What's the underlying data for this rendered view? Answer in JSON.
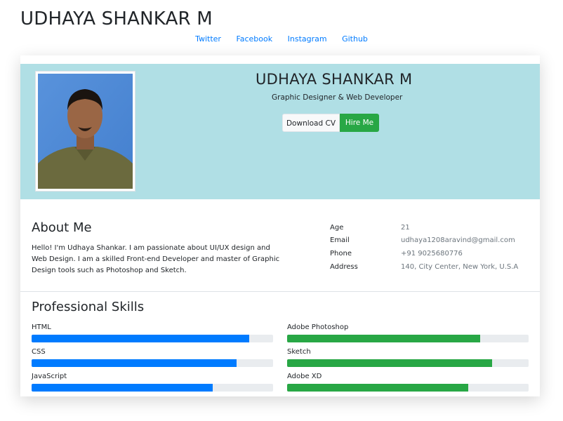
{
  "site": {
    "title": "UDHAYA SHANKAR M",
    "social": [
      "Twitter",
      "Facebook",
      "Instagram",
      "Github"
    ]
  },
  "hero": {
    "name": "UDHAYA SHANKAR M",
    "role": "Graphic Designer & Web Developer",
    "download_label": "Download CV",
    "hire_label": "Hire Me",
    "background_color": "#b0dfe5"
  },
  "about": {
    "title": "About Me",
    "text": "Hello! I'm Udhaya Shankar. I am passionate about UI/UX design and Web Design. I am a skilled Front-end Developer and master of Graphic Design tools such as Photoshop and Sketch.",
    "info": [
      {
        "key": "Age",
        "value": "21"
      },
      {
        "key": "Email",
        "value": "udhaya1208aravind@gmail.com"
      },
      {
        "key": "Phone",
        "value": "+91 9025680776"
      },
      {
        "key": "Address",
        "value": "140, City Center, New York, U.S.A"
      }
    ]
  },
  "skills": {
    "title": "Professional Skills",
    "colors": {
      "primary": "#007bff",
      "success": "#28a745"
    },
    "left": [
      {
        "name": "HTML",
        "percent": 90
      },
      {
        "name": "CSS",
        "percent": 85
      },
      {
        "name": "JavaScript",
        "percent": 75
      }
    ],
    "right": [
      {
        "name": "Adobe Photoshop",
        "percent": 80
      },
      {
        "name": "Sketch",
        "percent": 85
      },
      {
        "name": "Adobe XD",
        "percent": 75
      }
    ]
  }
}
